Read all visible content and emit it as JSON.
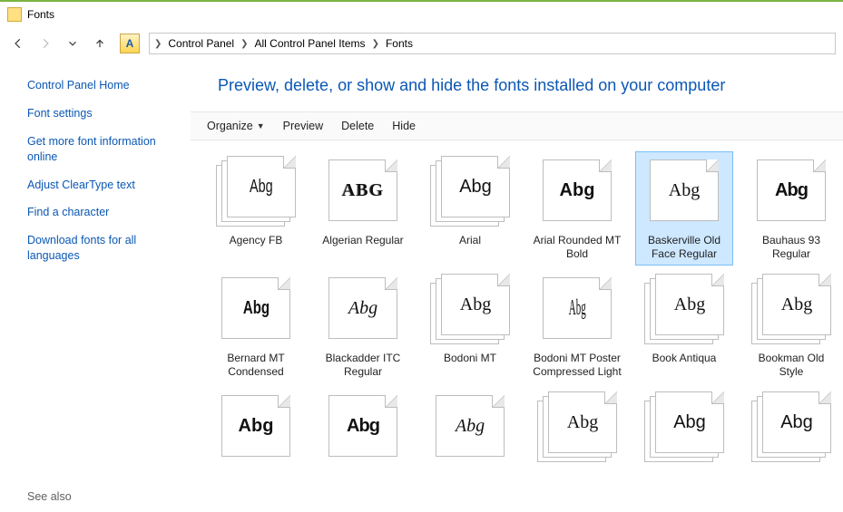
{
  "titlebar": {
    "title": "Fonts"
  },
  "breadcrumb": {
    "items": [
      "Control Panel",
      "All Control Panel Items",
      "Fonts"
    ]
  },
  "sidebar": {
    "home": "Control Panel Home",
    "links": [
      "Font settings",
      "Get more font information online",
      "Adjust ClearType text",
      "Find a character",
      "Download fonts for all languages"
    ],
    "see_also": "See also"
  },
  "main": {
    "heading": "Preview, delete, or show and hide the fonts installed on your computer"
  },
  "toolbar": {
    "organize": "Organize",
    "preview": "Preview",
    "delete": "Delete",
    "hide": "Hide"
  },
  "fonts": [
    {
      "name": "Agency FB",
      "stack": true,
      "selected": false,
      "sample": "Abg",
      "style": "st-narrow"
    },
    {
      "name": "Algerian Regular",
      "stack": false,
      "selected": false,
      "sample": "ABG",
      "style": "st-engrave"
    },
    {
      "name": "Arial",
      "stack": true,
      "selected": false,
      "sample": "Abg",
      "style": "st-arial"
    },
    {
      "name": "Arial Rounded MT Bold",
      "stack": false,
      "selected": false,
      "sample": "Abg",
      "style": "st-round"
    },
    {
      "name": "Baskerville Old Face Regular",
      "stack": false,
      "selected": true,
      "sample": "Abg",
      "style": "st-serif"
    },
    {
      "name": "Bauhaus 93 Regular",
      "stack": false,
      "selected": false,
      "sample": "Abg",
      "style": "st-geo"
    },
    {
      "name": "Bernard MT Condensed",
      "stack": false,
      "selected": false,
      "sample": "Abg",
      "style": "st-boldcond"
    },
    {
      "name": "Blackadder ITC Regular",
      "stack": false,
      "selected": false,
      "sample": "Abg",
      "style": "st-script"
    },
    {
      "name": "Bodoni MT",
      "stack": true,
      "selected": false,
      "sample": "Abg",
      "style": "st-bodoni"
    },
    {
      "name": "Bodoni MT Poster Compressed Light",
      "stack": false,
      "selected": false,
      "sample": "Abg",
      "style": "st-tallcond"
    },
    {
      "name": "Book Antiqua",
      "stack": true,
      "selected": false,
      "sample": "Abg",
      "style": "st-serif"
    },
    {
      "name": "Bookman Old Style",
      "stack": true,
      "selected": false,
      "sample": "Abg",
      "style": "st-serif"
    },
    {
      "name": "",
      "stack": false,
      "selected": false,
      "sample": "Abg",
      "style": "st-slab"
    },
    {
      "name": "",
      "stack": false,
      "selected": false,
      "sample": "Abg",
      "style": "st-fat"
    },
    {
      "name": "",
      "stack": false,
      "selected": false,
      "sample": "Abg",
      "style": "st-brush"
    },
    {
      "name": "",
      "stack": true,
      "selected": false,
      "sample": "Abg",
      "style": "st-serif"
    },
    {
      "name": "",
      "stack": true,
      "selected": false,
      "sample": "Abg",
      "style": "st-arial"
    },
    {
      "name": "",
      "stack": true,
      "selected": false,
      "sample": "Abg",
      "style": "st-arial"
    }
  ]
}
